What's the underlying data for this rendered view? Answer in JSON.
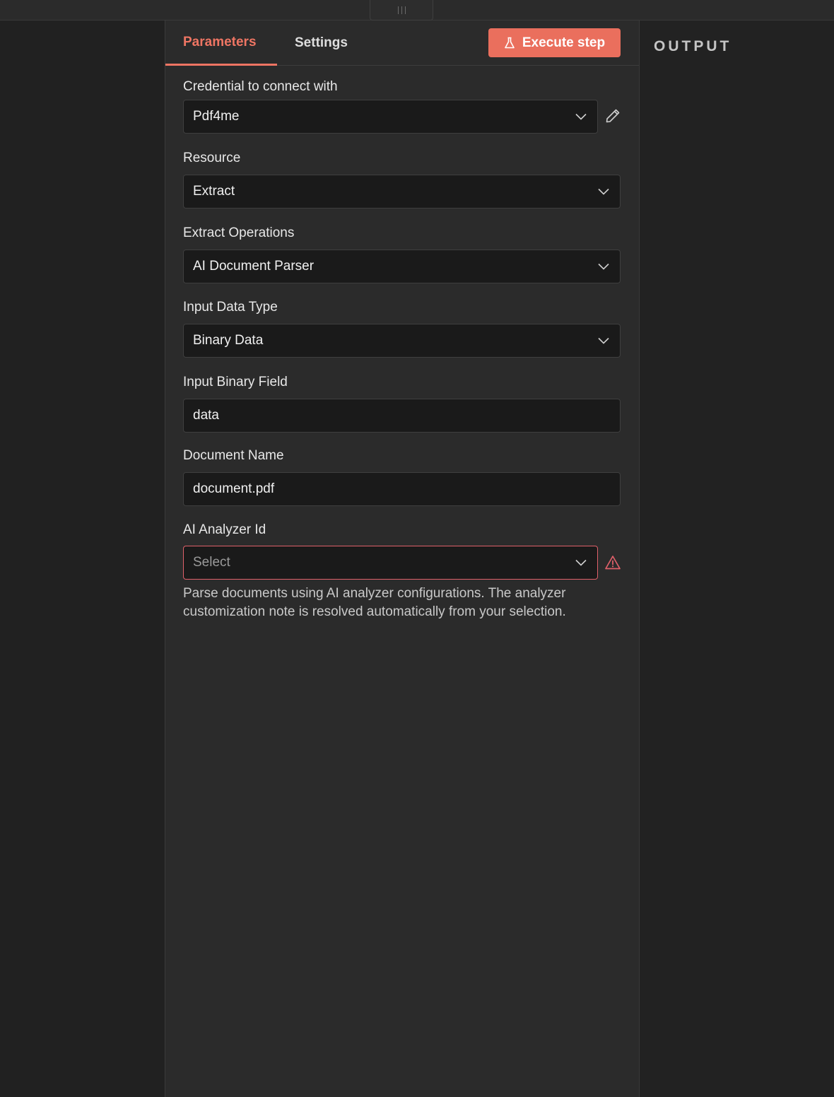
{
  "tabs": {
    "parameters": "Parameters",
    "settings": "Settings"
  },
  "execute_button": "Execute step",
  "fields": {
    "credential": {
      "label": "Credential to connect with",
      "value": "Pdf4me"
    },
    "resource": {
      "label": "Resource",
      "value": "Extract"
    },
    "operation": {
      "label": "Extract Operations",
      "value": "AI Document Parser"
    },
    "input_type": {
      "label": "Input Data Type",
      "value": "Binary Data"
    },
    "binary_field": {
      "label": "Input Binary Field",
      "value": "data"
    },
    "document_name": {
      "label": "Document Name",
      "value": "document.pdf"
    },
    "analyzer_id": {
      "label": "AI Analyzer Id",
      "placeholder": "Select"
    }
  },
  "hint": "Parse documents using AI analyzer configurations. The analyzer customization note is resolved automatically from your selection.",
  "output": {
    "title": "OUTPUT"
  },
  "colors": {
    "accent": "#ea6f5d",
    "error": "#e0606a",
    "panel": "#2b2b2b",
    "background": "#212121"
  },
  "icons": {
    "credential_edit": "pencil-icon",
    "analyzer_warning": "warning-triangle-icon",
    "execute": "flask-icon",
    "dropdown": "chevron-down-icon"
  }
}
